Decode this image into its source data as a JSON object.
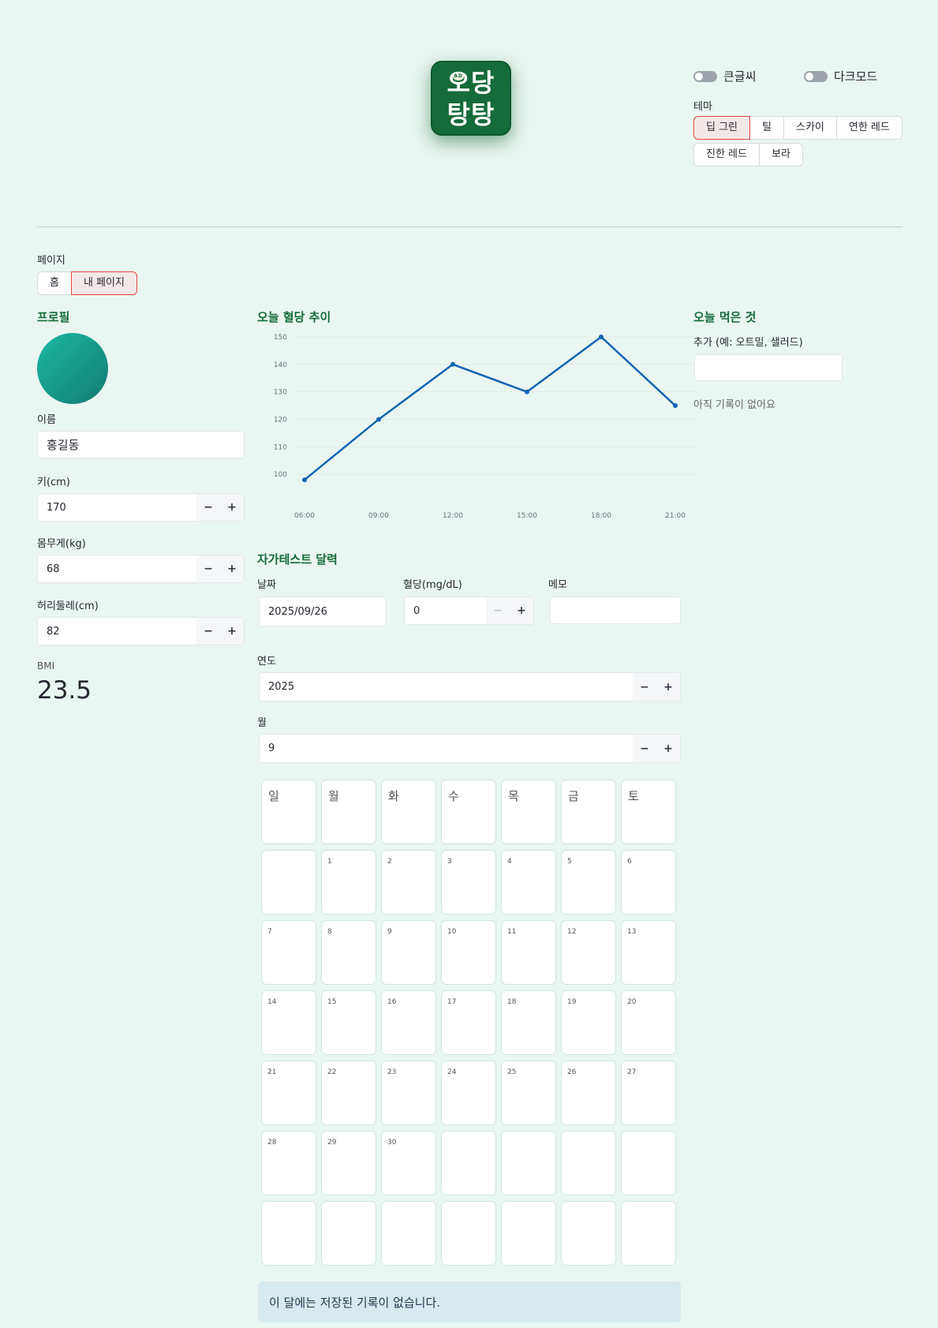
{
  "logo": {
    "line1": "오당",
    "line2": "탕탕",
    "mini": "AD"
  },
  "toggles": {
    "big_font": "큰글씨",
    "dark_mode": "다크모드"
  },
  "theme": {
    "label": "테마",
    "row1": [
      "딥 그린",
      "틸",
      "스카이",
      "연한 레드"
    ],
    "row2": [
      "진한 레드",
      "보라"
    ],
    "selected": "딥 그린"
  },
  "page_nav": {
    "label": "페이지",
    "options": [
      "홈",
      "내 페이지"
    ],
    "selected": "내 페이지"
  },
  "profile": {
    "title": "프로필",
    "name_label": "이름",
    "name_value": "홍길동",
    "height_label": "키(cm)",
    "height_value": "170",
    "weight_label": "몸무게(kg)",
    "weight_value": "68",
    "waist_label": "허리둘레(cm)",
    "waist_value": "82",
    "bmi_label": "BMI",
    "bmi_value": "23.5"
  },
  "stepper": {
    "minus": "−",
    "plus": "+"
  },
  "chart_section": {
    "title": "오늘 혈당 추이"
  },
  "chart_data": {
    "type": "line",
    "x": [
      "06:00",
      "09:00",
      "12:00",
      "15:00",
      "18:00",
      "21:00"
    ],
    "series": [
      {
        "values": [
          98,
          120,
          140,
          130,
          150,
          125
        ]
      }
    ],
    "y_ticks": [
      100,
      110,
      120,
      130,
      140,
      150
    ],
    "ylim": [
      94,
      152
    ],
    "grid": true,
    "line_color": "#1464b4"
  },
  "food": {
    "title": "오늘 먹은 것",
    "add_label": "추가 (예: 오트밀, 샐러드)",
    "add_value": "",
    "empty": "아직 기록이 없어요"
  },
  "calendar": {
    "title": "자가테스트 달력",
    "date_label": "날짜",
    "date_value": "2025/09/26",
    "glucose_label": "혈당(mg/dL)",
    "glucose_value": "0",
    "memo_label": "메모",
    "memo_value": "",
    "year_label": "연도",
    "year_value": "2025",
    "month_label": "월",
    "month_value": "9",
    "weekdays": [
      "일",
      "월",
      "화",
      "수",
      "목",
      "금",
      "토"
    ],
    "weeks": [
      [
        "",
        "1",
        "2",
        "3",
        "4",
        "5",
        "6"
      ],
      [
        "7",
        "8",
        "9",
        "10",
        "11",
        "12",
        "13"
      ],
      [
        "14",
        "15",
        "16",
        "17",
        "18",
        "19",
        "20"
      ],
      [
        "21",
        "22",
        "23",
        "24",
        "25",
        "26",
        "27"
      ],
      [
        "28",
        "29",
        "30",
        "",
        "",
        "",
        ""
      ],
      [
        "",
        "",
        "",
        "",
        "",
        "",
        ""
      ]
    ],
    "empty_notice": "이 달에는 저장된 기록이 없습니다."
  }
}
